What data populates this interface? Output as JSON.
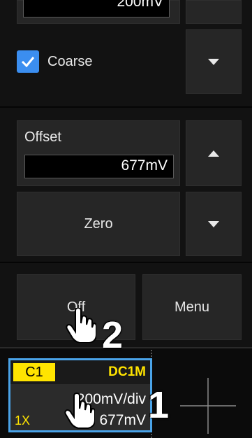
{
  "top_box": {
    "value": "200mV"
  },
  "coarse": {
    "label": "Coarse",
    "checked": true
  },
  "offset": {
    "label": "Offset",
    "value": "677mV"
  },
  "zero": {
    "label": "Zero"
  },
  "bottom_buttons": {
    "off": "Off",
    "menu": "Menu"
  },
  "channel": {
    "name": "C1",
    "coupling": "DC1M",
    "scale": "200mV/div",
    "probe": "1X",
    "offset": "677mV"
  },
  "callouts": {
    "one": "1",
    "two": "2"
  },
  "colors": {
    "accent_blue": "#3b8ef0",
    "channel_yellow": "#ffe400",
    "selection_border": "#4aa3e8"
  }
}
